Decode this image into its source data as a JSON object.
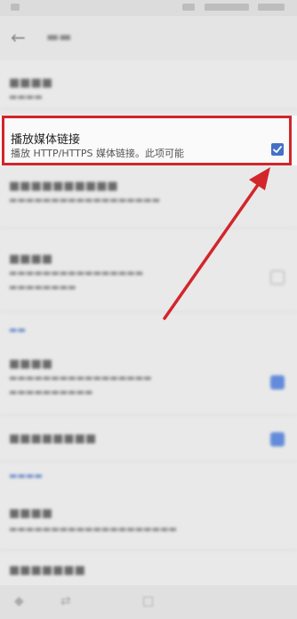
{
  "appbar": {
    "title": "播放媒体链接",
    "back_icon": "arrow-left-icon"
  },
  "highlighted": {
    "title": "播放媒体链接",
    "subtitle": "播放 HTTP/HTTPS 媒体链接。此项可能",
    "checked": true,
    "accent": "#d2262b"
  },
  "checkbox_color": "#4470c8",
  "arrow_color": "#d2262b"
}
